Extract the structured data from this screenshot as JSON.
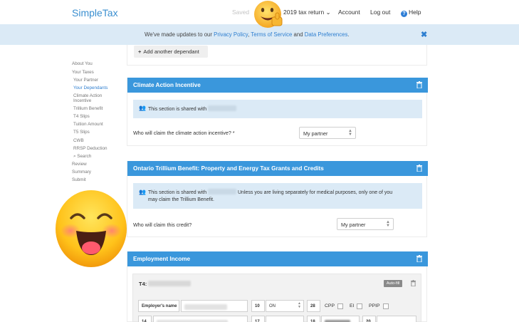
{
  "header": {
    "logo": "SimpleTax",
    "saved": "Saved",
    "return_label": "2019 tax return ⌄",
    "account": "Account",
    "logout": "Log out",
    "help": "Help"
  },
  "banner": {
    "prefix": "We've made updates to our ",
    "privacy": "Privacy Policy",
    "sep1": ", ",
    "terms": "Terms of Service",
    "sep2": " and ",
    "prefs": "Data Preferences",
    "suffix": ".",
    "close": "✖"
  },
  "sidebar": {
    "items": [
      "About You",
      "Your Taxes",
      "Your Partner",
      "Your Dependants",
      "Climate Action",
      "Incentive",
      "Trillium Benefit",
      "T4 Slips",
      "Tuition Amount",
      "T5 Slips",
      "CWB",
      "RRSP Deduction",
      "Search",
      "Review",
      "Summary",
      "Submit"
    ]
  },
  "dependants": {
    "add_label": "Add another dependant"
  },
  "climate": {
    "title": "Climate Action Incentive",
    "shared": "This section is shared with",
    "question": "Who will claim the climate action incentive? *",
    "selected": "My partner"
  },
  "trillium": {
    "title": "Ontario Trillium Benefit: Property and Energy Tax Grants and Credits",
    "shared": "This section is shared with",
    "shared_rest": "Unless you are living separately for medical purposes, only one of you",
    "shared_line2": "may claim the Trillium Benefit.",
    "question": "Who will claim this credit?",
    "selected": "My partner"
  },
  "employment": {
    "title": "Employment Income",
    "t4_label": "T4:",
    "autofill": "Auto-fill",
    "employer_label": "Employer's name",
    "box10": "10",
    "province": "ON",
    "box28": "28",
    "cpp": "CPP",
    "ei": "EI",
    "ppip": "PPIP",
    "box14": "14",
    "box17": "17",
    "box18": "18",
    "box20": "20"
  },
  "colors": {
    "accent": "#3a97dc",
    "banner": "#dbeaf6",
    "link": "#2f7fd0"
  }
}
